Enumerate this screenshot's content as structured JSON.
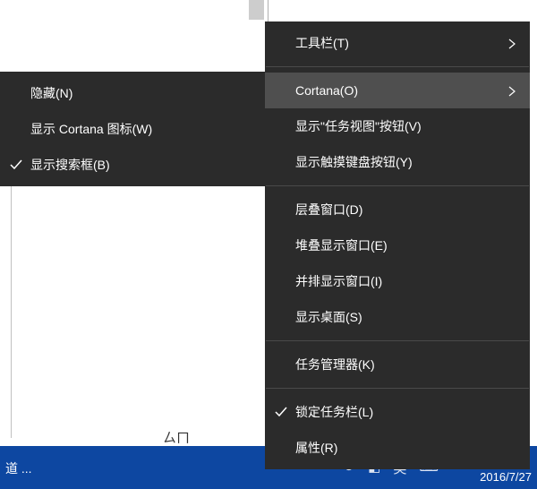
{
  "context_menu": {
    "items": [
      {
        "label": "工具栏(T)",
        "has_submenu": true,
        "checked": false
      },
      {
        "label": "Cortana(O)",
        "has_submenu": true,
        "checked": false,
        "highlighted": true
      },
      {
        "label": "显示\"任务视图\"按钮(V)",
        "checked": false
      },
      {
        "label": "显示触摸键盘按钮(Y)",
        "checked": false
      },
      {
        "label": "层叠窗口(D)",
        "checked": false
      },
      {
        "label": "堆叠显示窗口(E)",
        "checked": false
      },
      {
        "label": "并排显示窗口(I)",
        "checked": false
      },
      {
        "label": "显示桌面(S)",
        "checked": false
      },
      {
        "label": "任务管理器(K)",
        "checked": false
      },
      {
        "label": "锁定任务栏(L)",
        "checked": true
      },
      {
        "label": "属性(R)",
        "checked": false
      }
    ]
  },
  "cortana_submenu": {
    "items": [
      {
        "label": "隐藏(N)",
        "checked": false
      },
      {
        "label": "显示 Cortana 图标(W)",
        "checked": false
      },
      {
        "label": "显示搜索框(B)",
        "checked": true
      }
    ]
  },
  "background": {
    "partial_text": "ㄙㄇ"
  },
  "taskbar": {
    "left_text": "道 ...",
    "date": "2016/7/27"
  }
}
